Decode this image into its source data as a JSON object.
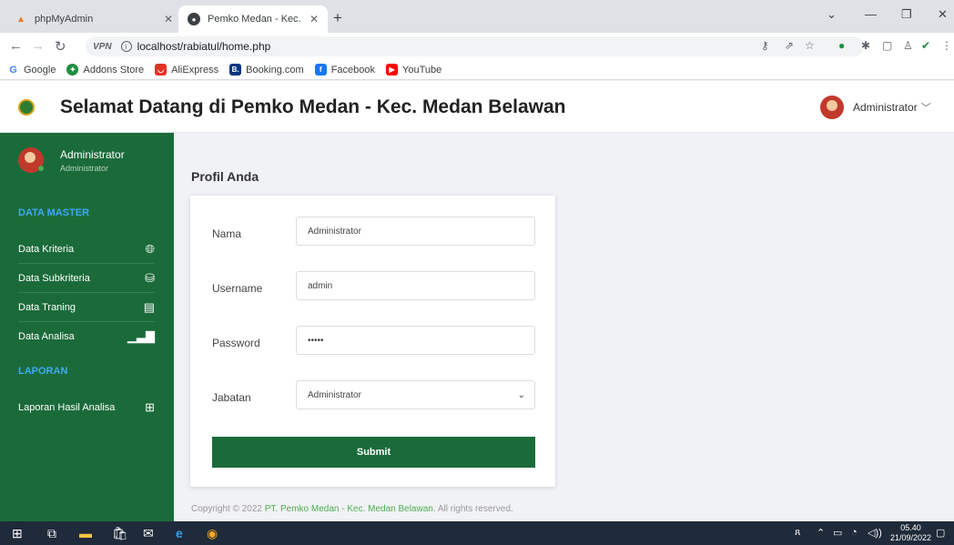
{
  "browser": {
    "tabs": [
      {
        "title": "phpMyAdmin",
        "icon": "phpmyadmin-icon"
      },
      {
        "title": "Pemko Medan - Kec. Medan Bela",
        "icon": "globe-icon"
      }
    ],
    "url": "localhost/rabiatul/home.php",
    "vpn_label": "VPN",
    "bookmarks": [
      "Google",
      "Addons Store",
      "AliExpress",
      "Booking.com",
      "Facebook",
      "YouTube"
    ]
  },
  "header": {
    "title": "Selamat Datang di Pemko Medan - Kec. Medan Belawan",
    "user": "Administrator"
  },
  "sidebar": {
    "user_name": "Administrator",
    "user_role": "Administrator",
    "sections": [
      {
        "title": "DATA MASTER",
        "items": [
          {
            "label": "Data Kriteria",
            "icon": "globe-icon"
          },
          {
            "label": "Data Subkriteria",
            "icon": "layers-icon"
          },
          {
            "label": "Data Traning",
            "icon": "book-icon"
          },
          {
            "label": "Data Analisa",
            "icon": "bar-chart-icon"
          }
        ]
      },
      {
        "title": "LAPORAN",
        "items": [
          {
            "label": "Laporan Hasil Analisa",
            "icon": "grid-icon"
          }
        ]
      }
    ]
  },
  "main": {
    "page_title": "Profil Anda",
    "form": {
      "nama_label": "Nama",
      "nama_value": "Administrator",
      "username_label": "Username",
      "username_value": "admin",
      "password_label": "Password",
      "password_value": "•••••",
      "jabatan_label": "Jabatan",
      "jabatan_value": "Administrator",
      "submit_label": "Submit"
    },
    "footer": {
      "prefix": "Copyright © 2022 ",
      "link": "PT. Pemko Medan - Kec. Medan Belawan",
      "suffix": ". All rights reserved."
    }
  },
  "taskbar": {
    "time": "05.40",
    "date": "21/09/2022"
  },
  "colors": {
    "sidebar": "#1b6b3a",
    "section_title": "#3fa9f5",
    "submit": "#1b6b3a",
    "footer_link": "#4caf50"
  }
}
